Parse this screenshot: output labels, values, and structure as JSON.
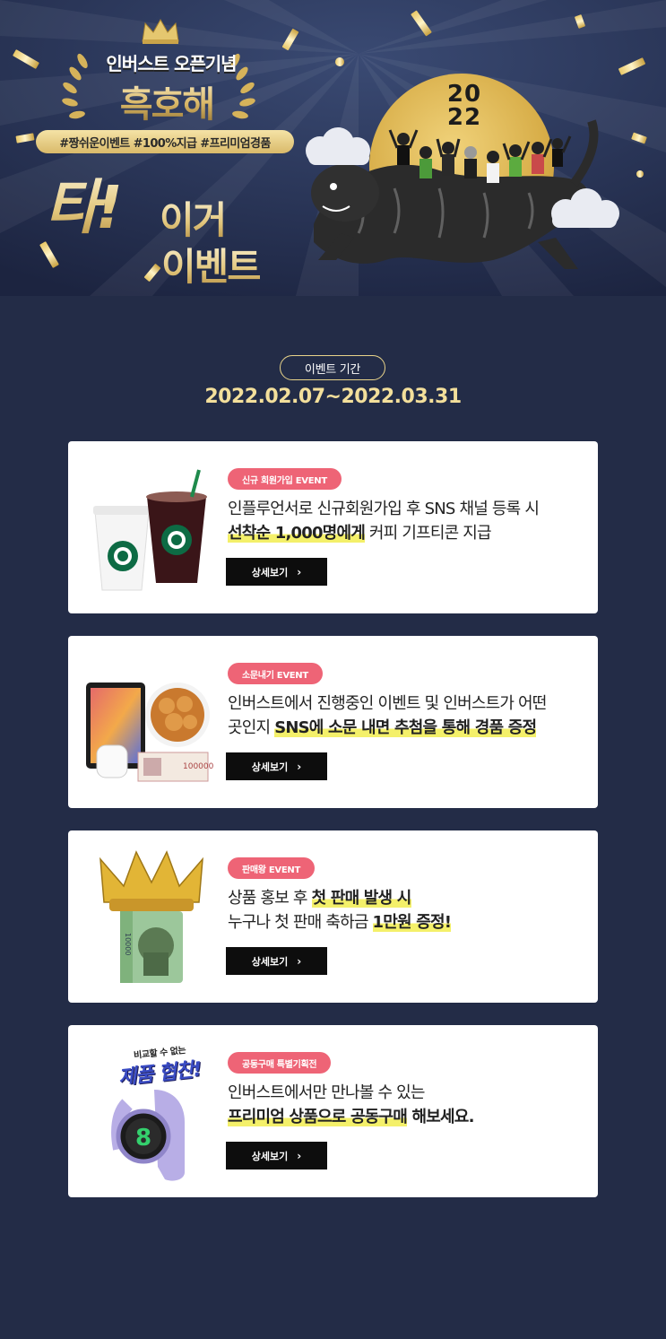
{
  "hero": {
    "subtitle": "인버스트 오픈기념",
    "title": "흑호해",
    "hashtags": "#짱쉬운이벤트 #100%지급 #프리미엄경품",
    "big_line1": "타!",
    "big_line2": "이거",
    "big_line3": "이벤트",
    "year_top": "20",
    "year_bottom": "22"
  },
  "period": {
    "label": "이벤트 기간",
    "dates": "2022.02.07~2022.03.31"
  },
  "cards": [
    {
      "tag": "신규 회원가입 EVENT",
      "line1": "인플루언서로 신규회원가입 후 SNS 채널 등록 시",
      "line2_highlight": "선착순 1,000명에게",
      "line2_rest": " 커피 기프티콘 지급",
      "button": "상세보기",
      "illustration": "starbucks-coffee-cups"
    },
    {
      "tag": "소문내기 EVENT",
      "line1": "인버스트에서 진행중인 이벤트 및 인버스트가 어떤",
      "line2_plain": "곳인지 ",
      "line2_highlight": "SNS에 소문 내면 추첨을 통해 경품 증정",
      "button": "상세보기",
      "illustration": "ipad-chicken-airpods-cash"
    },
    {
      "tag": "판매왕 EVENT",
      "line1_plain": "상품 홍보 후 ",
      "line1_highlight": "첫 판매 발생 시",
      "line2_plain": "누구나 첫 판매 축하금 ",
      "line2_highlight": "1만원 증정!",
      "button": "상세보기",
      "illustration": "crowned-banknote-roll"
    },
    {
      "tag": "공동구매 특별기획전",
      "line1": "인버스트에서만 만나볼 수 있는",
      "line2_highlight": "프리미엄 상품으로 공동구매",
      "line2_rest": " 해보세요.",
      "button": "상세보기",
      "illustration": "smartwatch",
      "badge_small": "비교할 수 없는",
      "badge_big": "제품 협찬!"
    }
  ],
  "colors": {
    "background": "#232c47",
    "gold": "#f3df9b",
    "tag": "#ee6476",
    "highlight": "#f4f06a",
    "button": "#0d0d0d"
  }
}
